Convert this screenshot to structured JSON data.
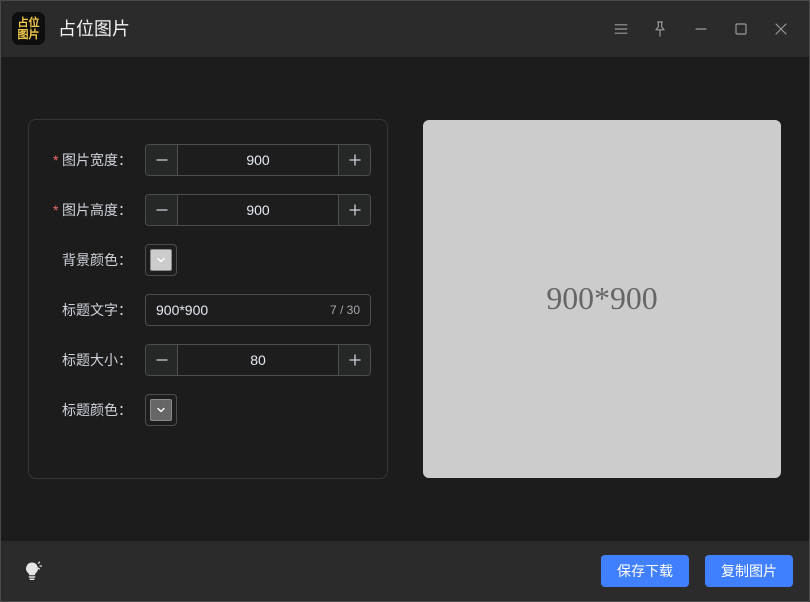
{
  "window": {
    "title": "占位图片",
    "app_icon_line1": "占位",
    "app_icon_line2": "图片",
    "app_icon_text_color": "#f2c94c"
  },
  "titlebar_controls": {
    "menu": "menu-icon",
    "pin": "pin-icon",
    "minimize": "minimize-icon",
    "maximize": "maximize-icon",
    "close": "close-icon"
  },
  "form": {
    "width": {
      "required_mark": "*",
      "label": "图片宽度：",
      "value": "900",
      "decrease_icon": "minus-icon",
      "increase_icon": "plus-icon"
    },
    "height": {
      "required_mark": "*",
      "label": "图片高度：",
      "value": "900",
      "decrease_icon": "minus-icon",
      "increase_icon": "plus-icon"
    },
    "background_color": {
      "label": "背景颜色：",
      "value": "#cccccc",
      "dropdown_icon": "chevron-down-icon"
    },
    "title_text": {
      "label": "标题文字：",
      "value": "900*900",
      "counter": "7 / 30"
    },
    "title_size": {
      "label": "标题大小：",
      "value": "80",
      "decrease_icon": "minus-icon",
      "increase_icon": "plus-icon"
    },
    "title_color": {
      "label": "标题颜色：",
      "value": "#666666",
      "dropdown_icon": "chevron-down-icon"
    }
  },
  "preview": {
    "text": "900*900"
  },
  "footer": {
    "theme_icon": "lightbulb-icon",
    "save_button": "保存下载",
    "copy_button": "复制图片"
  },
  "colors": {
    "accent": "#4080ff",
    "required": "#f56c6c"
  }
}
